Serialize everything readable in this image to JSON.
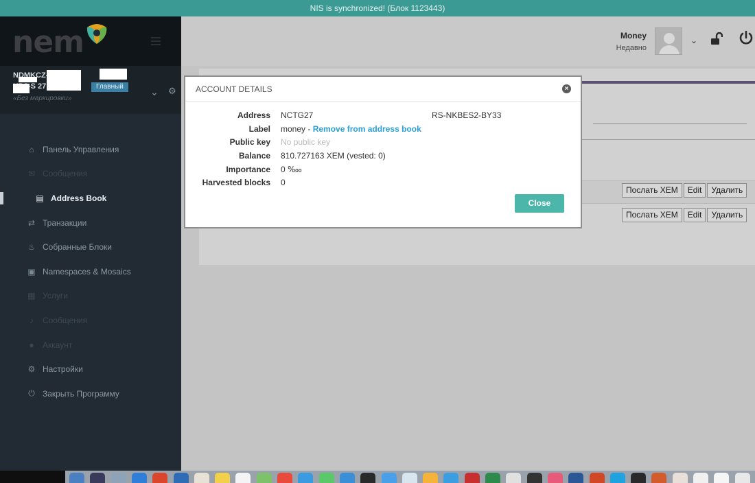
{
  "sync_bar": {
    "text": "NIS is synchronized! (Блок 1123443)"
  },
  "logo": {
    "text": "nem"
  },
  "account": {
    "address_line1": "NDMKCZ-          ZJMI      A-",
    "address_line2": "      KD2-S        27",
    "primary_badge": "Главный",
    "label": "«Без маркировки»"
  },
  "sidebar": {
    "items": [
      {
        "label": "Панель Управления",
        "icon": "home-icon",
        "state": "normal"
      },
      {
        "label": "Сообщения",
        "icon": "envelope-icon",
        "state": "dim"
      },
      {
        "label": "Address Book",
        "icon": "book-icon",
        "state": "active"
      },
      {
        "label": "Транзакции",
        "icon": "transfer-icon",
        "state": "normal"
      },
      {
        "label": "Собранные Блоки",
        "icon": "cutlery-icon",
        "state": "normal"
      },
      {
        "label": "Namespaces & Mosaics",
        "icon": "briefcase-icon",
        "state": "normal"
      },
      {
        "label": "Услуги",
        "icon": "cubes-icon",
        "state": "dim"
      },
      {
        "label": "Сообщения",
        "icon": "bell-icon",
        "state": "dim"
      },
      {
        "label": "Аккаунт",
        "icon": "user-icon",
        "state": "dim"
      },
      {
        "label": "Настройки",
        "icon": "gears-icon",
        "state": "normal"
      },
      {
        "label": "Закрыть Программу",
        "icon": "power-icon",
        "state": "normal"
      }
    ]
  },
  "header": {
    "user_name": "Money",
    "user_status": "Недавно"
  },
  "address_book": {
    "row_actions": [
      "Послать XEM",
      "Edit",
      "Удалить"
    ]
  },
  "modal": {
    "title": "ACCOUNT DETAILS",
    "fields": [
      {
        "label": "Address",
        "value": "NCTG27",
        "value_tail": "RS-NKBES2-BY33"
      },
      {
        "label": "Label",
        "value": "money",
        "sep": " - ",
        "link": "Remove from address book"
      },
      {
        "label": "Public key",
        "value": "No public key"
      },
      {
        "label": "Balance",
        "value": "810.727163 XEM (vested: 0)"
      },
      {
        "label": "Importance",
        "value": "0 ‱"
      },
      {
        "label": "Harvested blocks",
        "value": "0"
      }
    ],
    "close_label": "Close"
  },
  "colors": {
    "sync_bar": "#3c9a94",
    "sidebar": "#222b33",
    "accent_teal": "#4cb6ab",
    "link_blue": "#2a9fd6",
    "badge_blue": "#3b7fa5"
  }
}
